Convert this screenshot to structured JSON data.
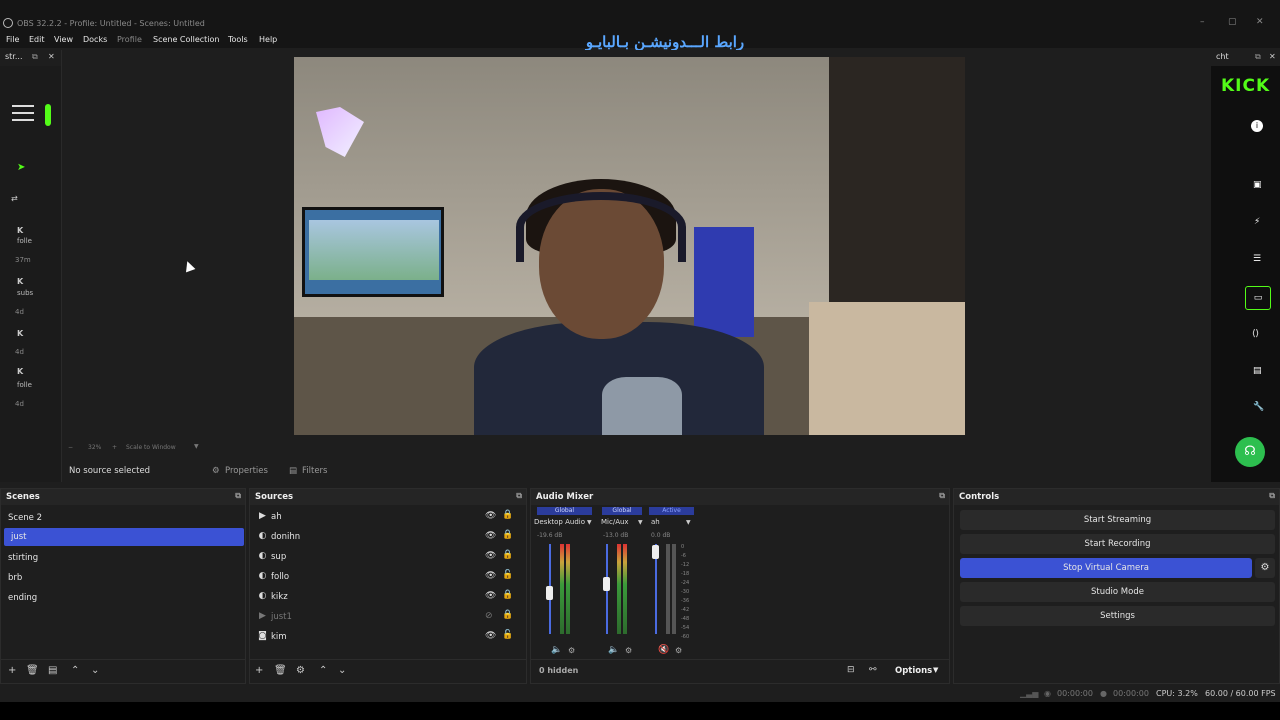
{
  "window": {
    "title": "OBS 32.2.2 - Profile: Untitled - Scenes: Untitled"
  },
  "menu": [
    "File",
    "Edit",
    "View",
    "Docks",
    "Profile",
    "Scene Collection",
    "Tools",
    "Help"
  ],
  "banner_text": "رابط الـــدونيشـن بـالبايـو",
  "left_dock": {
    "title": "str...",
    "items": [
      "folle",
      "37m",
      "subs",
      "4d",
      "4d",
      "folle",
      "4d"
    ]
  },
  "right_dock": {
    "title": "cht",
    "brand": "KICK"
  },
  "preview": {
    "zoom": "32%",
    "scale_mode": "Scale to Window"
  },
  "source_bar": {
    "status": "No source selected",
    "properties": "Properties",
    "filters": "Filters"
  },
  "scenes": {
    "title": "Scenes",
    "items": [
      "Scene 2",
      "just",
      "stirting",
      "brb",
      "ending"
    ],
    "selected": "just"
  },
  "sources": {
    "title": "Sources",
    "items": [
      {
        "name": "ah",
        "icon": "play-icon",
        "visible": true,
        "locked": true
      },
      {
        "name": "donihn",
        "icon": "globe-icon",
        "visible": true,
        "locked": true
      },
      {
        "name": "sup",
        "icon": "globe-icon",
        "visible": true,
        "locked": true
      },
      {
        "name": "follo",
        "icon": "globe-icon",
        "visible": true,
        "locked": false
      },
      {
        "name": "kikz",
        "icon": "globe-icon",
        "visible": true,
        "locked": true
      },
      {
        "name": "just1",
        "icon": "play-icon",
        "visible": false,
        "locked": true
      },
      {
        "name": "kim",
        "icon": "camera-icon",
        "visible": true,
        "locked": false
      }
    ]
  },
  "audio_mixer": {
    "title": "Audio Mixer",
    "hidden_label": "0 hidden",
    "options_label": "Options",
    "channels": [
      {
        "tag": "Global",
        "name": "Desktop Audio",
        "db": "-19.6 dB"
      },
      {
        "tag": "Global",
        "name": "Mic/Aux",
        "db": "-13.0 dB"
      },
      {
        "tag": "Active",
        "name": "ah",
        "db": "0.0 dB"
      }
    ],
    "scale": [
      "0",
      "-6",
      "-12",
      "-18",
      "-24",
      "-30",
      "-36",
      "-42",
      "-48",
      "-54",
      "-60"
    ]
  },
  "controls": {
    "title": "Controls",
    "buttons": [
      "Start Streaming",
      "Start Recording",
      "Stop Virtual Camera",
      "Studio Mode",
      "Settings"
    ]
  },
  "status": {
    "stream_time": "00:00:00",
    "rec_time": "00:00:00",
    "cpu": "CPU: 3.2%",
    "fps": "60.00 / 60.00 FPS"
  }
}
